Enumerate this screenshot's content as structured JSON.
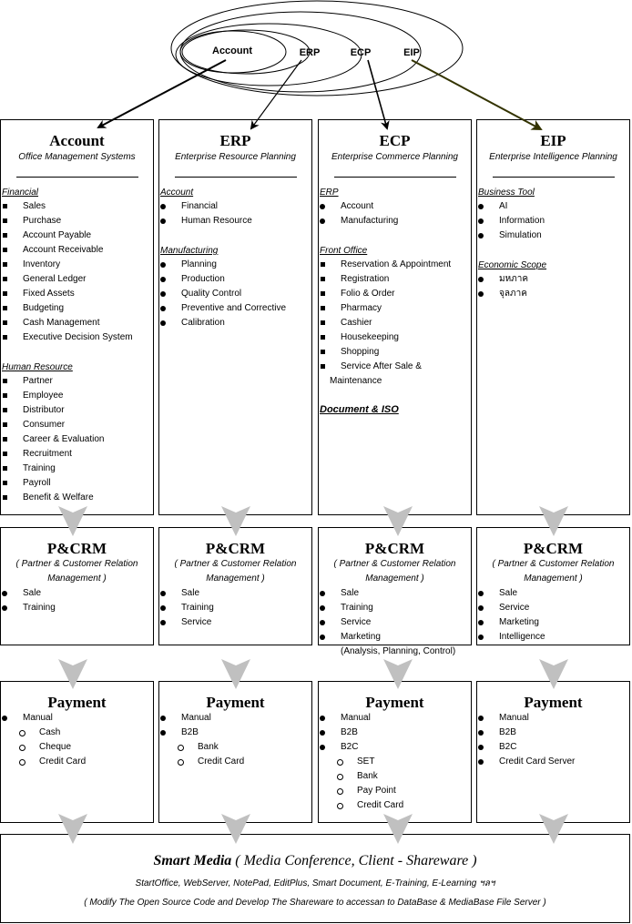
{
  "ovals": {
    "labels": [
      "Account",
      "ERP",
      "ECP",
      "EIP"
    ]
  },
  "colors": {
    "arrow_dark": "#000000",
    "arrow_eip": "#333300",
    "flow_arrow": "#c0c0c0",
    "border": "#000000"
  },
  "columns": [
    {
      "title": "Account",
      "subtitle": "Office Management Systems",
      "sections": [
        {
          "heading": "Financial",
          "bullet": "square",
          "items": [
            "Sales",
            "Purchase",
            "Account Payable",
            "Account Receivable",
            "Inventory",
            "General Ledger",
            "Fixed Assets",
            "Budgeting",
            "Cash Management",
            "Executive Decision System"
          ]
        },
        {
          "heading": "Human Resource",
          "bullet": "square",
          "items": [
            "Partner",
            "Employee",
            "Distributor",
            "Consumer",
            "Career & Evaluation",
            "Recruitment",
            "Training",
            "Payroll",
            "Benefit & Welfare"
          ]
        }
      ]
    },
    {
      "title": "ERP",
      "subtitle": "Enterprise Resource Planning",
      "sections": [
        {
          "heading": "Account",
          "bullet": "dot",
          "items": [
            "Financial",
            "Human Resource"
          ]
        },
        {
          "heading": "Manufacturing",
          "bullet": "dot",
          "items": [
            "Planning",
            "Production",
            "Quality Control",
            "Preventive and Corrective",
            "Calibration"
          ]
        }
      ]
    },
    {
      "title": "ECP",
      "subtitle": "Enterprise Commerce Planning",
      "sections": [
        {
          "heading": "ERP",
          "bullet": "dot",
          "items": [
            "Account",
            "Manufacturing"
          ]
        },
        {
          "heading": "Front Office",
          "bullet": "square",
          "items": [
            "Reservation & Appointment",
            "Registration",
            "Folio & Order",
            "Pharmacy",
            "Cashier",
            "Housekeeping",
            "Shopping",
            "Service After Sale &"
          ]
        }
      ],
      "continuation": "Maintenance",
      "extra_heading": "Document & ISO"
    },
    {
      "title": "EIP",
      "subtitle": "Enterprise Intelligence Planning",
      "sections": [
        {
          "heading": "Business Tool",
          "bullet": "dot",
          "items": [
            "AI",
            "Information",
            "Simulation"
          ]
        },
        {
          "heading": "Economic Scope",
          "bullet": "dot",
          "items": [
            "มหภาค",
            "จุลภาค"
          ]
        }
      ]
    }
  ],
  "crm": {
    "title": "P&CRM",
    "subtitle_1": "( Partner & Customer Relation",
    "subtitle_2": "Management )",
    "columns": [
      {
        "items": [
          "Sale",
          "Training"
        ]
      },
      {
        "items": [
          "Sale",
          "Training",
          "Service"
        ]
      },
      {
        "items": [
          "Sale",
          "Training",
          "Service",
          "Marketing"
        ],
        "continuation": "(Analysis, Planning, Control)"
      },
      {
        "items": [
          "Sale",
          "Service",
          "Marketing",
          "Intelligence"
        ]
      }
    ]
  },
  "payment": {
    "title": "Payment",
    "columns": [
      {
        "items": [
          {
            "label": "Manual",
            "level": 1
          },
          {
            "label": "Cash",
            "level": 2
          },
          {
            "label": "Cheque",
            "level": 2
          },
          {
            "label": "Credit Card",
            "level": 2
          }
        ]
      },
      {
        "items": [
          {
            "label": "Manual",
            "level": 1
          },
          {
            "label": "B2B",
            "level": 1
          },
          {
            "label": "Bank",
            "level": 2
          },
          {
            "label": "Credit Card",
            "level": 2
          }
        ]
      },
      {
        "items": [
          {
            "label": "Manual",
            "level": 1
          },
          {
            "label": "B2B",
            "level": 1
          },
          {
            "label": "B2C",
            "level": 1
          },
          {
            "label": "SET",
            "level": 2
          },
          {
            "label": "Bank",
            "level": 2
          },
          {
            "label": "Pay Point",
            "level": 2
          },
          {
            "label": "Credit Card",
            "level": 2
          }
        ]
      },
      {
        "items": [
          {
            "label": "Manual",
            "level": 1
          },
          {
            "label": "B2B",
            "level": 1
          },
          {
            "label": "B2C",
            "level": 1
          },
          {
            "label": "Credit Card Server",
            "level": 1
          }
        ]
      }
    ]
  },
  "smart_media": {
    "title": "Smart Media",
    "title_suffix": " ( Media Conference, Client - Shareware )",
    "tools": "StartOffice, WebServer, NotePad, EditPlus, Smart Document, E-Training, E-Learning ฯลฯ",
    "note": "( Modify The Open Source Code and Develop The Shareware to accessan to DataBase & MediaBase File Server )"
  }
}
